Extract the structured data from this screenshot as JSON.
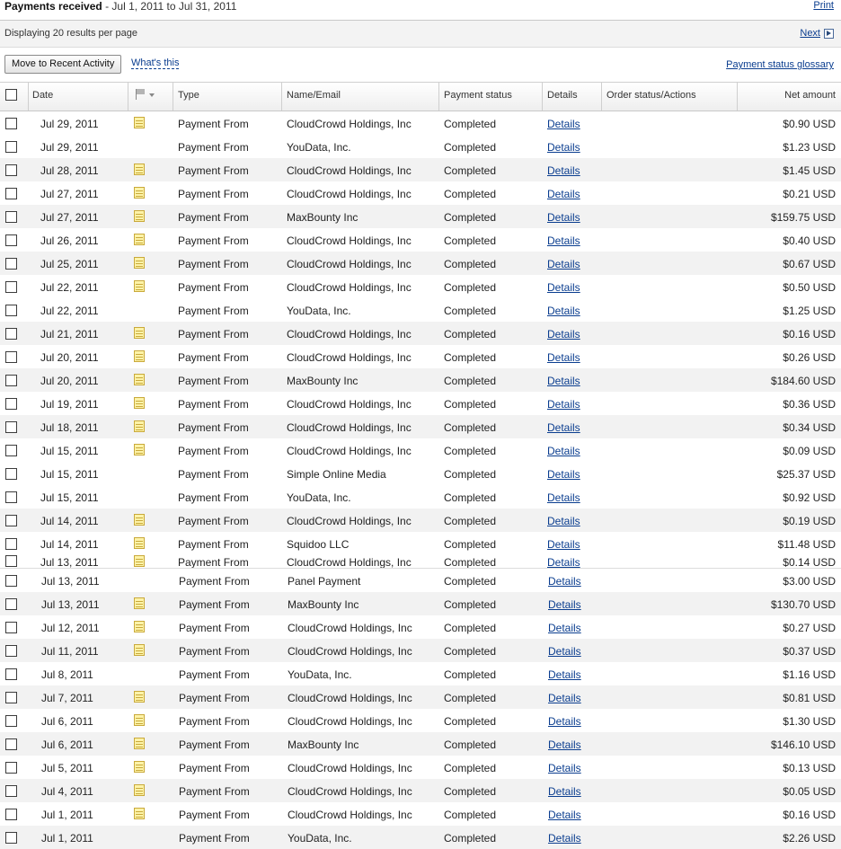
{
  "header": {
    "title_bold": "Payments received",
    "title_range": " - Jul 1, 2011 to Jul 31, 2011",
    "print_label": "Print"
  },
  "paging": {
    "display_text": "Displaying 20 results per page",
    "next_label": "Next"
  },
  "actions": {
    "move_button": "Move to Recent Activity",
    "whats_this": "What's this",
    "glossary_link": "Payment status glossary"
  },
  "columns": {
    "date": "Date",
    "type": "Type",
    "name": "Name/Email",
    "status": "Payment status",
    "details": "Details",
    "order": "Order status/Actions",
    "amount": "Net amount"
  },
  "rows": [
    {
      "date": "Jul 29, 2011",
      "note": true,
      "type": "Payment From",
      "name": "CloudCrowd Holdings, Inc",
      "status": "Completed",
      "details": "Details",
      "amount": "$0.90 USD"
    },
    {
      "date": "Jul 29, 2011",
      "note": false,
      "type": "Payment From",
      "name": "YouData, Inc.",
      "status": "Completed",
      "details": "Details",
      "amount": "$1.23 USD"
    },
    {
      "date": "Jul 28, 2011",
      "note": true,
      "type": "Payment From",
      "name": "CloudCrowd Holdings, Inc",
      "status": "Completed",
      "details": "Details",
      "amount": "$1.45 USD"
    },
    {
      "date": "Jul 27, 2011",
      "note": true,
      "type": "Payment From",
      "name": "CloudCrowd Holdings, Inc",
      "status": "Completed",
      "details": "Details",
      "amount": "$0.21 USD"
    },
    {
      "date": "Jul 27, 2011",
      "note": true,
      "type": "Payment From",
      "name": "MaxBounty Inc",
      "status": "Completed",
      "details": "Details",
      "amount": "$159.75 USD"
    },
    {
      "date": "Jul 26, 2011",
      "note": true,
      "type": "Payment From",
      "name": "CloudCrowd Holdings, Inc",
      "status": "Completed",
      "details": "Details",
      "amount": "$0.40 USD"
    },
    {
      "date": "Jul 25, 2011",
      "note": true,
      "type": "Payment From",
      "name": "CloudCrowd Holdings, Inc",
      "status": "Completed",
      "details": "Details",
      "amount": "$0.67 USD"
    },
    {
      "date": "Jul 22, 2011",
      "note": true,
      "type": "Payment From",
      "name": "CloudCrowd Holdings, Inc",
      "status": "Completed",
      "details": "Details",
      "amount": "$0.50 USD"
    },
    {
      "date": "Jul 22, 2011",
      "note": false,
      "type": "Payment From",
      "name": "YouData, Inc.",
      "status": "Completed",
      "details": "Details",
      "amount": "$1.25 USD"
    },
    {
      "date": "Jul 21, 2011",
      "note": true,
      "type": "Payment From",
      "name": "CloudCrowd Holdings, Inc",
      "status": "Completed",
      "details": "Details",
      "amount": "$0.16 USD"
    },
    {
      "date": "Jul 20, 2011",
      "note": true,
      "type": "Payment From",
      "name": "CloudCrowd Holdings, Inc",
      "status": "Completed",
      "details": "Details",
      "amount": "$0.26 USD"
    },
    {
      "date": "Jul 20, 2011",
      "note": true,
      "type": "Payment From",
      "name": "MaxBounty Inc",
      "status": "Completed",
      "details": "Details",
      "amount": "$184.60 USD"
    },
    {
      "date": "Jul 19, 2011",
      "note": true,
      "type": "Payment From",
      "name": "CloudCrowd Holdings, Inc",
      "status": "Completed",
      "details": "Details",
      "amount": "$0.36 USD"
    },
    {
      "date": "Jul 18, 2011",
      "note": true,
      "type": "Payment From",
      "name": "CloudCrowd Holdings, Inc",
      "status": "Completed",
      "details": "Details",
      "amount": "$0.34 USD"
    },
    {
      "date": "Jul 15, 2011",
      "note": true,
      "type": "Payment From",
      "name": "CloudCrowd Holdings, Inc",
      "status": "Completed",
      "details": "Details",
      "amount": "$0.09 USD"
    },
    {
      "date": "Jul 15, 2011",
      "note": false,
      "type": "Payment From",
      "name": "Simple Online Media",
      "status": "Completed",
      "details": "Details",
      "amount": "$25.37 USD"
    },
    {
      "date": "Jul 15, 2011",
      "note": false,
      "type": "Payment From",
      "name": "YouData, Inc.",
      "status": "Completed",
      "details": "Details",
      "amount": "$0.92 USD"
    },
    {
      "date": "Jul 14, 2011",
      "note": true,
      "type": "Payment From",
      "name": "CloudCrowd Holdings, Inc",
      "status": "Completed",
      "details": "Details",
      "amount": "$0.19 USD"
    },
    {
      "date": "Jul 14, 2011",
      "note": true,
      "type": "Payment From",
      "name": "Squidoo LLC",
      "status": "Completed",
      "details": "Details",
      "amount": "$11.48 USD"
    },
    {
      "date": "Jul 13, 2011",
      "note": true,
      "type": "Payment From",
      "name": "CloudCrowd Holdings, Inc",
      "status": "Completed",
      "details": "Details",
      "amount": "$0.14 USD"
    },
    {
      "date": "Jul 13, 2011",
      "note": false,
      "type": "Payment From",
      "name": "Panel Payment",
      "status": "Completed",
      "details": "Details",
      "amount": "$3.00 USD"
    },
    {
      "date": "Jul 13, 2011",
      "note": true,
      "type": "Payment From",
      "name": "MaxBounty Inc",
      "status": "Completed",
      "details": "Details",
      "amount": "$130.70 USD"
    },
    {
      "date": "Jul 12, 2011",
      "note": true,
      "type": "Payment From",
      "name": "CloudCrowd Holdings, Inc",
      "status": "Completed",
      "details": "Details",
      "amount": "$0.27 USD"
    },
    {
      "date": "Jul 11, 2011",
      "note": true,
      "type": "Payment From",
      "name": "CloudCrowd Holdings, Inc",
      "status": "Completed",
      "details": "Details",
      "amount": "$0.37 USD"
    },
    {
      "date": "Jul 8, 2011",
      "note": false,
      "type": "Payment From",
      "name": "YouData, Inc.",
      "status": "Completed",
      "details": "Details",
      "amount": "$1.16 USD"
    },
    {
      "date": "Jul 7, 2011",
      "note": true,
      "type": "Payment From",
      "name": "CloudCrowd Holdings, Inc",
      "status": "Completed",
      "details": "Details",
      "amount": "$0.81 USD"
    },
    {
      "date": "Jul 6, 2011",
      "note": true,
      "type": "Payment From",
      "name": "CloudCrowd Holdings, Inc",
      "status": "Completed",
      "details": "Details",
      "amount": "$1.30 USD"
    },
    {
      "date": "Jul 6, 2011",
      "note": true,
      "type": "Payment From",
      "name": "MaxBounty Inc",
      "status": "Completed",
      "details": "Details",
      "amount": "$146.10 USD"
    },
    {
      "date": "Jul 5, 2011",
      "note": true,
      "type": "Payment From",
      "name": "CloudCrowd Holdings, Inc",
      "status": "Completed",
      "details": "Details",
      "amount": "$0.13 USD"
    },
    {
      "date": "Jul 4, 2011",
      "note": true,
      "type": "Payment From",
      "name": "CloudCrowd Holdings, Inc",
      "status": "Completed",
      "details": "Details",
      "amount": "$0.05 USD"
    },
    {
      "date": "Jul 1, 2011",
      "note": true,
      "type": "Payment From",
      "name": "CloudCrowd Holdings, Inc",
      "status": "Completed",
      "details": "Details",
      "amount": "$0.16 USD"
    },
    {
      "date": "Jul 1, 2011",
      "note": false,
      "type": "Payment From",
      "name": "YouData, Inc.",
      "status": "Completed",
      "details": "Details",
      "amount": "$2.26 USD"
    }
  ]
}
